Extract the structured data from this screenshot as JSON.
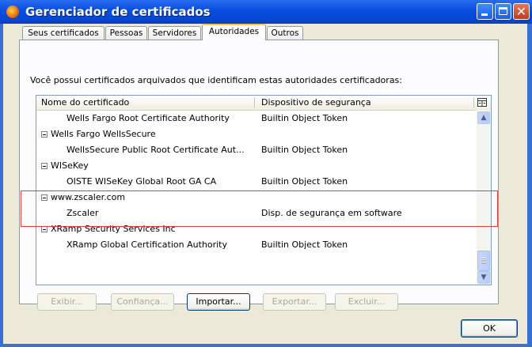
{
  "window": {
    "title": "Gerenciador de certificados",
    "icon": "firefox-icon",
    "controls": {
      "minimize": "minimize-icon",
      "maximize": "maximize-icon",
      "close": "✕"
    }
  },
  "tabs": [
    {
      "label": "Seus certificados",
      "active": false
    },
    {
      "label": "Pessoas",
      "active": false
    },
    {
      "label": "Servidores",
      "active": false
    },
    {
      "label": "Autoridades",
      "active": true
    },
    {
      "label": "Outros",
      "active": false
    }
  ],
  "description": "Você possui certificados arquivados que identificam estas autoridades certificadoras:",
  "tree": {
    "columns": {
      "name": "Nome do certificado",
      "device": "Dispositivo de segurança",
      "picker_icon": "column-picker-icon"
    },
    "rows": [
      {
        "type": "cert",
        "name": "Wells Fargo Root Certificate Authority",
        "device": "Builtin Object Token"
      },
      {
        "type": "group",
        "name": "Wells Fargo WellsSecure",
        "device": ""
      },
      {
        "type": "cert",
        "name": "WellsSecure Public Root Certificate Aut...",
        "device": "Builtin Object Token"
      },
      {
        "type": "group",
        "name": "WISeKey",
        "device": ""
      },
      {
        "type": "cert",
        "name": "OISTE WISeKey Global Root GA CA",
        "device": "Builtin Object Token"
      },
      {
        "type": "group",
        "name": "www.zscaler.com",
        "device": ""
      },
      {
        "type": "cert",
        "name": "Zscaler",
        "device": "Disp. de segurança em software"
      },
      {
        "type": "group",
        "name": "XRamp Security Services Inc",
        "device": ""
      },
      {
        "type": "cert",
        "name": "XRamp Global Certification Authority",
        "device": "Builtin Object Token"
      }
    ],
    "scroll_position": 0.95
  },
  "actions": [
    {
      "label": "Exibir...",
      "enabled": false
    },
    {
      "label": "Confiança...",
      "enabled": false
    },
    {
      "label": "Importar...",
      "enabled": true
    },
    {
      "label": "Exportar...",
      "enabled": false
    },
    {
      "label": "Excluir...",
      "enabled": false
    }
  ],
  "ok_label": "OK",
  "colors": {
    "titlebar": "#0a4fe0",
    "dialog": "#ece9d8",
    "active_tab": "#ffc83c",
    "highlight": "#e53b3b"
  }
}
